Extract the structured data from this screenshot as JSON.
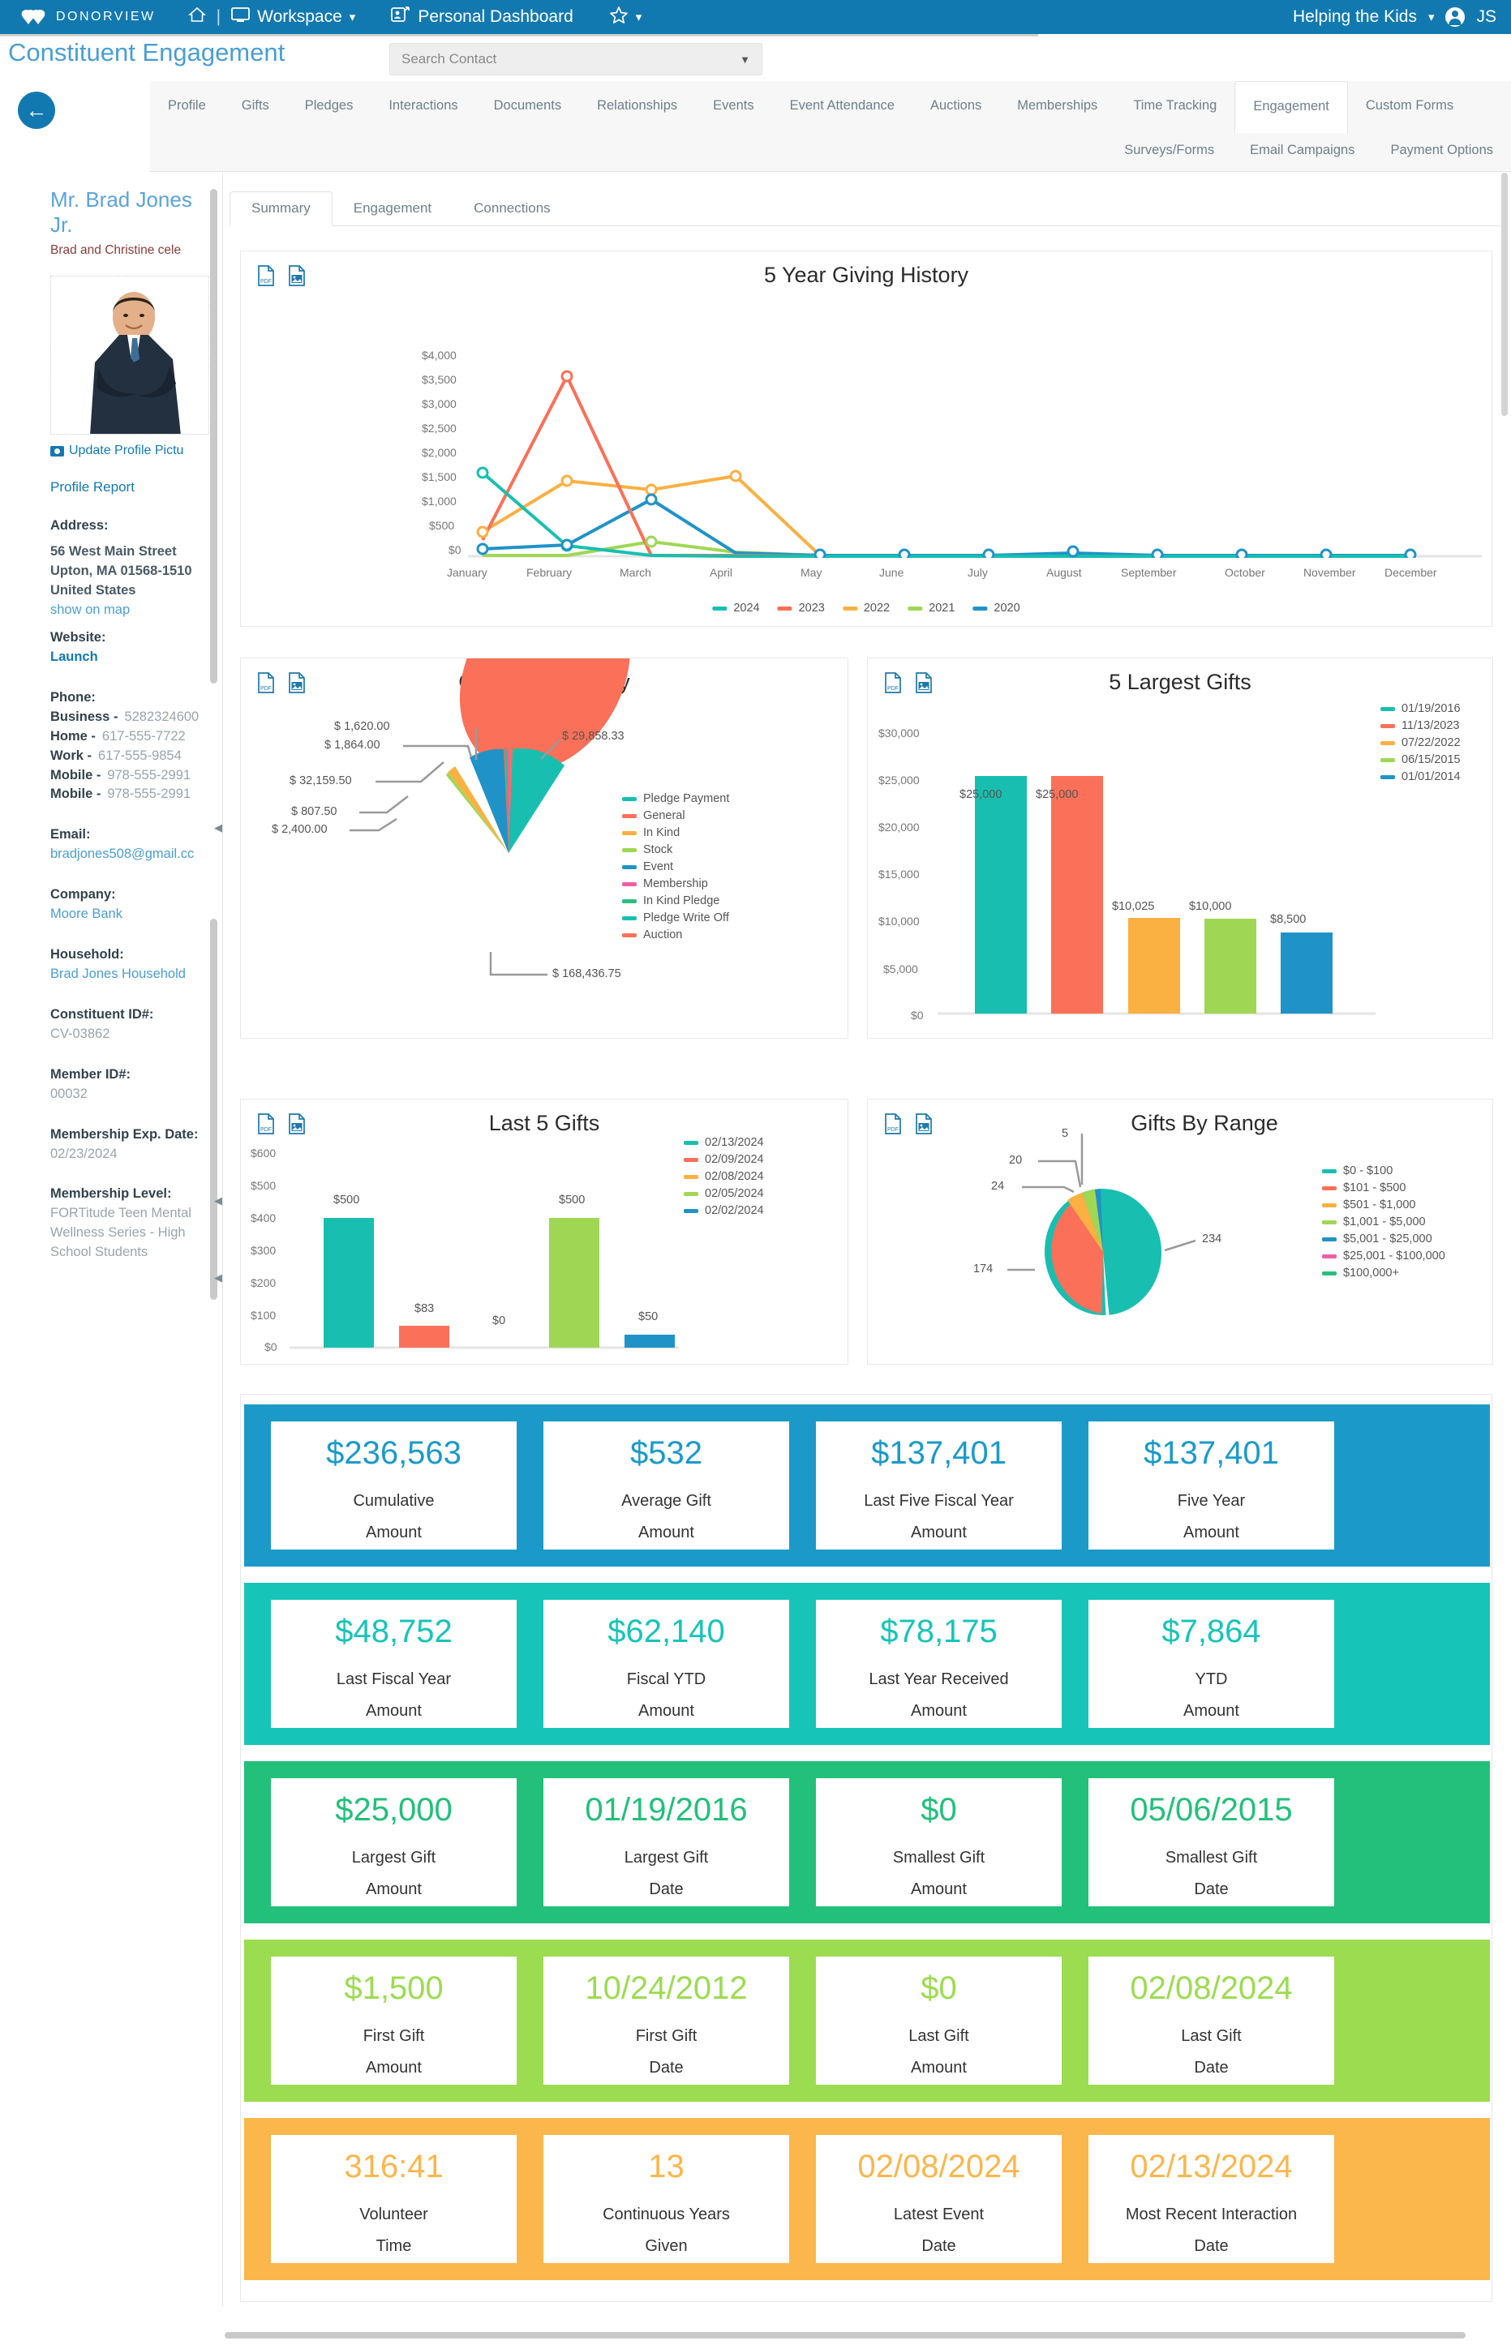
{
  "topbar": {
    "brand": "DONORVIEW",
    "home_icon": "home-icon",
    "workspace": "Workspace",
    "personal_dashboard": "Personal Dashboard",
    "star_icon": "star-icon",
    "org": "Helping the Kids",
    "user_initials": "JS"
  },
  "page": {
    "title": "Constituent Engagement",
    "search_placeholder": "Search Contact",
    "back_icon": "arrow-left-icon"
  },
  "tabs": {
    "row1": [
      "Profile",
      "Gifts",
      "Pledges",
      "Interactions",
      "Documents",
      "Relationships",
      "Events",
      "Event Attendance",
      "Auctions",
      "Memberships",
      "Time Tracking",
      "Engagement",
      "Custom Forms"
    ],
    "row2": [
      "Surveys/Forms",
      "Email Campaigns",
      "Payment Options"
    ],
    "active": "Engagement"
  },
  "subtabs": {
    "items": [
      "Summary",
      "Engagement",
      "Connections"
    ],
    "active": "Summary"
  },
  "sidebar": {
    "name": "Mr. Brad Jones Jr.",
    "note": "Brad and Christine cele",
    "update_photo": "Update Profile Pictu",
    "profile_report": "Profile Report",
    "address_label": "Address:",
    "address_lines": [
      "56 West Main Street",
      "Upton, MA 01568-1510",
      "United States"
    ],
    "show_on_map": "show on map",
    "website_label": "Website:",
    "website_link": "Launch",
    "phone_label": "Phone:",
    "phones": [
      {
        "kind": "Business -",
        "number": "5282324600"
      },
      {
        "kind": "Home -",
        "number": "617-555-7722"
      },
      {
        "kind": "Work -",
        "number": "617-555-9854"
      },
      {
        "kind": "Mobile -",
        "number": "978-555-2991"
      },
      {
        "kind": "Mobile -",
        "number": "978-555-2991"
      }
    ],
    "email_label": "Email:",
    "email": "bradjones508@gmail.cc",
    "company_label": "Company:",
    "company": "Moore Bank",
    "household_label": "Household:",
    "household": "Brad Jones Household",
    "constituent_id_label": "Constituent ID#:",
    "constituent_id": "CV-03862",
    "member_id_label": "Member ID#:",
    "member_id": "00032",
    "membership_exp_label": "Membership Exp. Date:",
    "membership_exp": "02/23/2024",
    "membership_level_label": "Membership Level:",
    "membership_level": "FORTitude Teen Mental Wellness Series - High School Students"
  },
  "card_icons": {
    "pdf": "pdf-export-icon",
    "image": "image-export-icon"
  },
  "chart_data": [
    {
      "type": "line",
      "id": "five-year-giving-history",
      "title": "5 Year Giving History",
      "xlabel": "",
      "ylabel": "",
      "ylim": [
        0,
        4000
      ],
      "yticks": [
        "$0",
        "$500",
        "$1,000",
        "$1,500",
        "$2,000",
        "$2,500",
        "$3,000",
        "$3,500",
        "$4,000"
      ],
      "categories": [
        "January",
        "February",
        "March",
        "April",
        "May",
        "June",
        "July",
        "August",
        "September",
        "October",
        "November",
        "December"
      ],
      "legend_position": "bottom",
      "series": [
        {
          "name": "2024",
          "color": "#18bfb0",
          "values": [
            1640,
            220,
            20,
            10,
            0,
            0,
            0,
            0,
            0,
            0,
            0,
            0
          ]
        },
        {
          "name": "2023",
          "color": "#fa7058",
          "values": [
            330,
            3530,
            20,
            20,
            0,
            0,
            0,
            0,
            0,
            0,
            0,
            0
          ]
        },
        {
          "name": "2022",
          "color": "#fbb042",
          "values": [
            500,
            1480,
            1300,
            1580,
            20,
            0,
            0,
            0,
            0,
            0,
            0,
            0
          ]
        },
        {
          "name": "2021",
          "color": "#9fd755",
          "values": [
            30,
            30,
            290,
            80,
            10,
            0,
            0,
            0,
            0,
            0,
            0,
            0
          ]
        },
        {
          "name": "2020",
          "color": "#1f93c8",
          "values": [
            150,
            240,
            1120,
            60,
            20,
            20,
            20,
            70,
            20,
            20,
            20,
            20
          ]
        }
      ]
    },
    {
      "type": "pie",
      "id": "gifts-by-category",
      "title": "Gifts By Category",
      "legend_position": "right",
      "labels": [
        "Pledge Payment",
        "General",
        "In Kind",
        "Stock",
        "Event",
        "Membership",
        "In Kind Pledge",
        "Pledge Write Off",
        "Auction"
      ],
      "colors": [
        "#18bfb0",
        "#fa7058",
        "#fbb042",
        "#9fd755",
        "#1f93c8",
        "#ef5fa7",
        "#2bbf7f",
        "#18bfb0",
        "#fa7058"
      ],
      "values": [
        29858.33,
        168436.75,
        2400.0,
        807.5,
        32159.5,
        1864.0,
        1620.0,
        0,
        0
      ],
      "callouts": [
        "$ 1,620.00",
        "$ 1,864.00",
        "$ 32,159.50",
        "$ 807.50",
        "$ 2,400.00",
        "$ 29,858.33",
        "$ 168,436.75"
      ]
    },
    {
      "type": "bar",
      "id": "five-largest-gifts",
      "title": "5 Largest Gifts",
      "ylim": [
        0,
        30000
      ],
      "yticks": [
        "$0",
        "$5,000",
        "$10,000",
        "$15,000",
        "$20,000",
        "$25,000",
        "$30,000"
      ],
      "categories": [
        "01/19/2016",
        "11/13/2023",
        "07/22/2022",
        "06/15/2015",
        "01/01/2014"
      ],
      "values": [
        25000,
        25000,
        10025,
        10000,
        8500
      ],
      "value_labels": [
        "$25,000",
        "$25,000",
        "$10,025",
        "$10,000",
        "$8,500"
      ],
      "colors": [
        "#18bfb0",
        "#fa7058",
        "#fbb042",
        "#9fd755",
        "#1f93c8"
      ],
      "legend_position": "top-right"
    },
    {
      "type": "bar",
      "id": "last-five-gifts",
      "title": "Last 5 Gifts",
      "ylim": [
        0,
        600
      ],
      "yticks": [
        "$0",
        "$100",
        "$200",
        "$300",
        "$400",
        "$500",
        "$600"
      ],
      "categories": [
        "02/13/2024",
        "02/09/2024",
        "02/08/2024",
        "02/05/2024",
        "02/02/2024"
      ],
      "values": [
        500,
        83,
        0,
        500,
        50
      ],
      "value_labels": [
        "$500",
        "$83",
        "$0",
        "$500",
        "$50"
      ],
      "colors": [
        "#18bfb0",
        "#fa7058",
        "#fbb042",
        "#9fd755",
        "#1f93c8"
      ],
      "legend_position": "top-right"
    },
    {
      "type": "pie",
      "id": "gifts-by-range",
      "title": "Gifts By Range",
      "legend_position": "right",
      "labels": [
        "$0 - $100",
        "$101 - $500",
        "$501 - $1,000",
        "$1,001 - $5,000",
        "$5,001 - $25,000",
        "$25,001 - $100,000",
        "$100,000+"
      ],
      "colors": [
        "#18bfb0",
        "#fa7058",
        "#fbb042",
        "#9fd755",
        "#1f93c8",
        "#ef5fa7",
        "#2bbf7f"
      ],
      "values": [
        234,
        174,
        24,
        20,
        5,
        0,
        0
      ],
      "callouts": [
        "5",
        "20",
        "24",
        "174",
        "234"
      ]
    }
  ],
  "kpi": {
    "bands": [
      {
        "color": "#1b9ac9",
        "tiles": [
          {
            "value": "$236,563",
            "line1": "Cumulative",
            "line2": "Amount"
          },
          {
            "value": "$532",
            "line1": "Average Gift",
            "line2": "Amount"
          },
          {
            "value": "$137,401",
            "line1": "Last Five Fiscal Year",
            "line2": "Amount"
          },
          {
            "value": "$137,401",
            "line1": "Five Year",
            "line2": "Amount"
          }
        ]
      },
      {
        "color": "#17c4b8",
        "tiles": [
          {
            "value": "$48,752",
            "line1": "Last Fiscal Year",
            "line2": "Amount"
          },
          {
            "value": "$62,140",
            "line1": "Fiscal YTD",
            "line2": "Amount"
          },
          {
            "value": "$78,175",
            "line1": "Last Year Received",
            "line2": "Amount"
          },
          {
            "value": "$7,864",
            "line1": "YTD",
            "line2": "Amount"
          }
        ]
      },
      {
        "color": "#22c07a",
        "tiles": [
          {
            "value": "$25,000",
            "line1": "Largest Gift",
            "line2": "Amount"
          },
          {
            "value": "01/19/2016",
            "line1": "Largest Gift",
            "line2": "Date"
          },
          {
            "value": "$0",
            "line1": "Smallest Gift",
            "line2": "Amount"
          },
          {
            "value": "05/06/2015",
            "line1": "Smallest Gift",
            "line2": "Date"
          }
        ]
      },
      {
        "color": "#9cdc50",
        "tiles": [
          {
            "value": "$1,500",
            "line1": "First Gift",
            "line2": "Amount"
          },
          {
            "value": "10/24/2012",
            "line1": "First Gift",
            "line2": "Date"
          },
          {
            "value": "$0",
            "line1": "Last Gift",
            "line2": "Amount"
          },
          {
            "value": "02/08/2024",
            "line1": "Last Gift",
            "line2": "Date"
          }
        ]
      },
      {
        "color": "#fbb64c",
        "tiles": [
          {
            "value": "316:41",
            "line1": "Volunteer",
            "line2": "Time"
          },
          {
            "value": "13",
            "line1": "Continuous Years",
            "line2": "Given"
          },
          {
            "value": "02/08/2024",
            "line1": "Latest Event",
            "line2": "Date"
          },
          {
            "value": "02/13/2024",
            "line1": "Most Recent Interaction",
            "line2": "Date"
          }
        ]
      }
    ]
  }
}
